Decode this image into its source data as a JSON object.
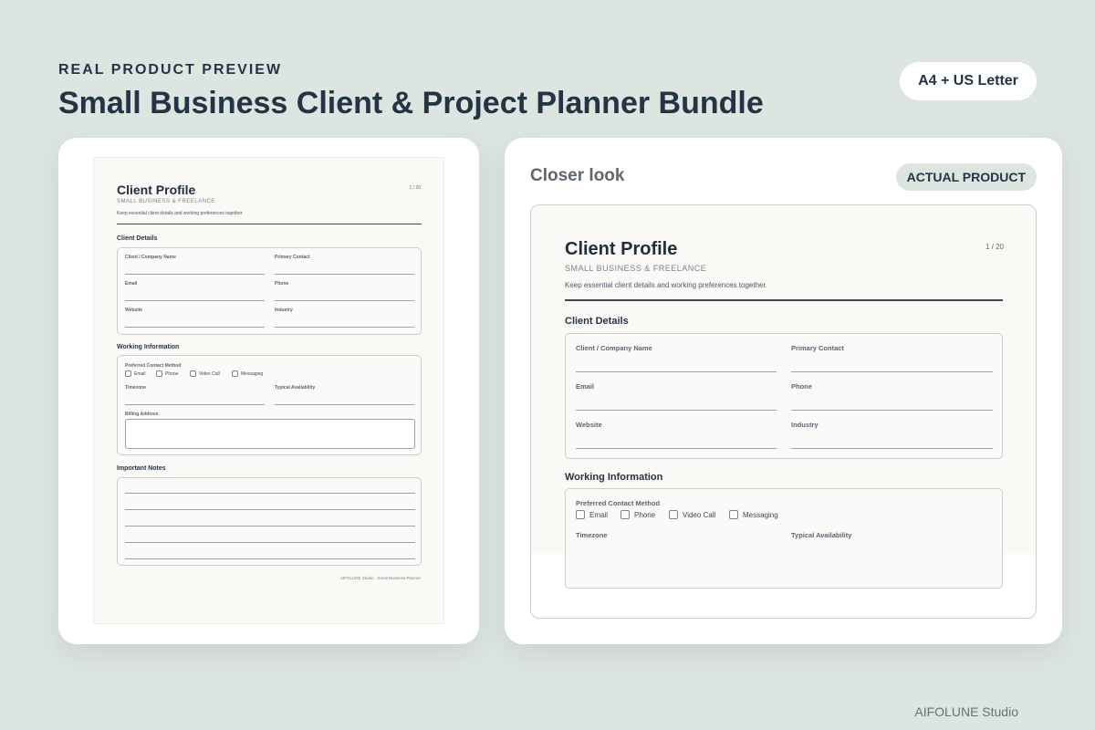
{
  "header": {
    "eyebrow": "REAL PRODUCT PREVIEW",
    "title": "Small Business Client & Project Planner Bundle",
    "format_badge": "A4 + US Letter"
  },
  "closer": {
    "label": "Closer look",
    "badge": "ACTUAL PRODUCT"
  },
  "document": {
    "title": "Client Profile",
    "page_indicator": "1 / 20",
    "subtitle": "SMALL BUSINESS & FREELANCE",
    "description": "Keep essential client details and working preferences together.",
    "sections": {
      "client_details": {
        "heading": "Client Details",
        "fields": [
          "Client / Company Name",
          "Primary Contact",
          "Email",
          "Phone",
          "Website",
          "Industry"
        ]
      },
      "working_info": {
        "heading": "Working Information",
        "contact_method_label": "Preferred Contact Method",
        "contact_options": [
          "Email",
          "Phone",
          "Video Call",
          "Messaging"
        ],
        "fields": [
          "Timezone",
          "Typical Availability"
        ],
        "billing_label": "Billing Address"
      },
      "notes": {
        "heading": "Important Notes"
      }
    },
    "footer": "AIFOLUNE Studio · Small Business Planner"
  },
  "studio_name": "AIFOLUNE Studio",
  "colors": {
    "background": "#dde5e1",
    "ink": "#243444",
    "paper": "#faf9f6",
    "card": "#ffffff"
  }
}
